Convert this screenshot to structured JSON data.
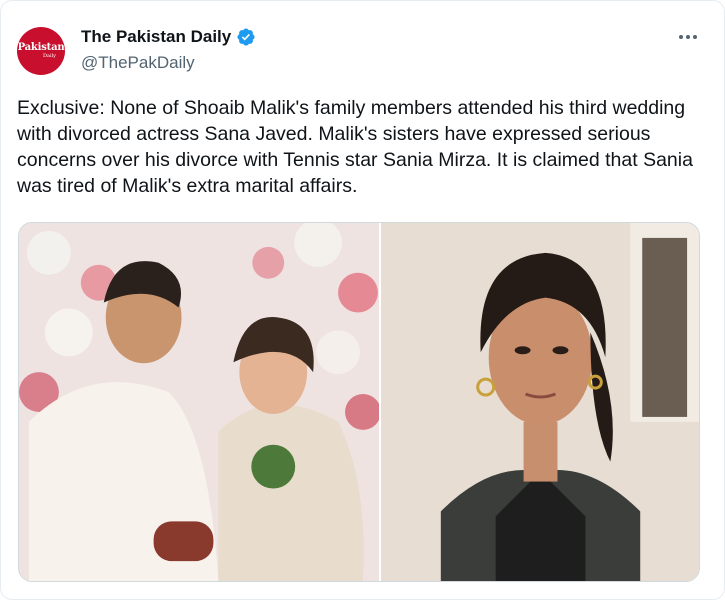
{
  "author": {
    "display_name": "The Pakistan Daily",
    "handle": "@ThePakDaily",
    "verified": true,
    "avatar": {
      "logo_text": "Pakistan",
      "logo_sub": "Daily",
      "color": "#c8102e"
    }
  },
  "tweet": {
    "text": "Exclusive: None of Shoaib Malik's family members attended his third wedding with divorced actress Sana Javed. Malik's sisters have expressed serious concerns over his divorce with Tennis star Sania Mirza. It is claimed that Sania was tired of Malik's extra marital affairs."
  },
  "media": [
    {
      "icon": "wedding-couple-photo"
    },
    {
      "icon": "woman-portrait-photo"
    }
  ],
  "colors": {
    "text": "#0f1419",
    "secondary": "#536471",
    "verified_badge": "#1d9bf0",
    "border": "#cfd9de"
  },
  "icons": {
    "more": "more-options-icon",
    "verified": "verified-badge-icon"
  }
}
